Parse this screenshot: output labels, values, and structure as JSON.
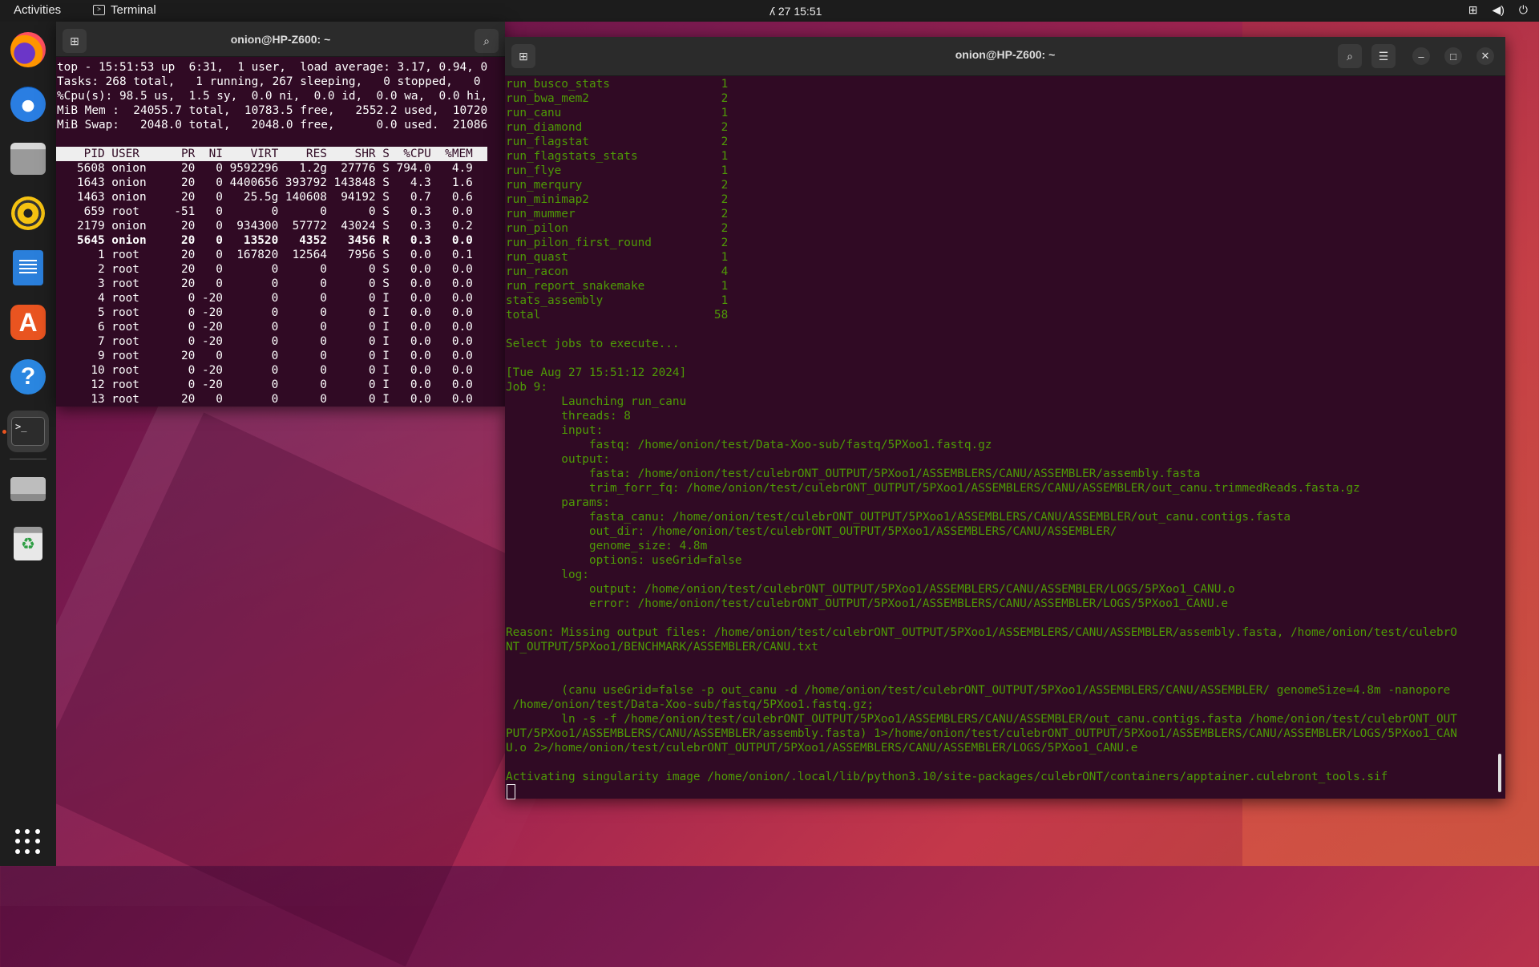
{
  "topbar": {
    "activities": "Activities",
    "app_name": "Terminal",
    "clock": "ʎ 27  15:51",
    "tray": [
      "network-icon",
      "volume-icon",
      "power-icon"
    ]
  },
  "dock": {
    "items": [
      "firefox",
      "thunderbird",
      "files",
      "rhythmbox",
      "libreoffice-writer",
      "app-center",
      "help",
      "terminal",
      "drive",
      "trash",
      "show-apps"
    ],
    "active": "terminal"
  },
  "term_top": {
    "title": "onion@HP-Z600: ~",
    "summary": [
      "top - 15:51:53 up  6:31,  1 user,  load average: 3.17, 0.94, 0",
      "Tasks: 268 total,   1 running, 267 sleeping,   0 stopped,   0",
      "%Cpu(s): 98.5 us,  1.5 sy,  0.0 ni,  0.0 id,  0.0 wa,  0.0 hi,",
      "MiB Mem :  24055.7 total,  10783.5 free,   2552.2 used,  10720",
      "MiB Swap:   2048.0 total,   2048.0 free,      0.0 used.  21086"
    ],
    "header": "    PID USER      PR  NI    VIRT    RES    SHR S  %CPU  %MEM ",
    "rows": [
      "   5608 onion     20   0 9592296   1.2g  27776 S 794.0   4.9",
      "   1643 onion     20   0 4400656 393792 143848 S   4.3   1.6",
      "   1463 onion     20   0   25.5g 140608  94192 S   0.7   0.6",
      "    659 root     -51   0       0      0      0 S   0.3   0.0",
      "   2179 onion     20   0  934300  57772  43024 S   0.3   0.2",
      "   5645 onion     20   0   13520   4352   3456 R   0.3   0.0",
      "      1 root      20   0  167820  12564   7956 S   0.0   0.1",
      "      2 root      20   0       0      0      0 S   0.0   0.0",
      "      3 root      20   0       0      0      0 S   0.0   0.0",
      "      4 root       0 -20       0      0      0 I   0.0   0.0",
      "      5 root       0 -20       0      0      0 I   0.0   0.0",
      "      6 root       0 -20       0      0      0 I   0.0   0.0",
      "      7 root       0 -20       0      0      0 I   0.0   0.0",
      "      9 root      20   0       0      0      0 I   0.0   0.0",
      "     10 root       0 -20       0      0      0 I   0.0   0.0",
      "     12 root       0 -20       0      0      0 I   0.0   0.0",
      "     13 root      20   0       0      0      0 I   0.0   0.0"
    ]
  },
  "term_main": {
    "title": "onion@HP-Z600: ~",
    "lines": [
      "run_busco_stats                1",
      "run_bwa_mem2                   2",
      "run_canu                       1",
      "run_diamond                    2",
      "run_flagstat                   2",
      "run_flagstats_stats            1",
      "run_flye                       1",
      "run_merqury                    2",
      "run_minimap2                   2",
      "run_mummer                     2",
      "run_pilon                      2",
      "run_pilon_first_round          2",
      "run_quast                      1",
      "run_racon                      4",
      "run_report_snakemake           1",
      "stats_assembly                 1",
      "total                         58",
      "",
      "Select jobs to execute...",
      "",
      "[Tue Aug 27 15:51:12 2024]",
      "Job 9:",
      "        Launching run_canu",
      "        threads: 8",
      "        input:",
      "            fastq: /home/onion/test/Data-Xoo-sub/fastq/5PXoo1.fastq.gz",
      "        output:",
      "            fasta: /home/onion/test/culebrONT_OUTPUT/5PXoo1/ASSEMBLERS/CANU/ASSEMBLER/assembly.fasta",
      "            trim_forr_fq: /home/onion/test/culebrONT_OUTPUT/5PXoo1/ASSEMBLERS/CANU/ASSEMBLER/out_canu.trimmedReads.fasta.gz",
      "        params:",
      "            fasta_canu: /home/onion/test/culebrONT_OUTPUT/5PXoo1/ASSEMBLERS/CANU/ASSEMBLER/out_canu.contigs.fasta",
      "            out_dir: /home/onion/test/culebrONT_OUTPUT/5PXoo1/ASSEMBLERS/CANU/ASSEMBLER/",
      "            genome_size: 4.8m",
      "            options: useGrid=false",
      "        log:",
      "            output: /home/onion/test/culebrONT_OUTPUT/5PXoo1/ASSEMBLERS/CANU/ASSEMBLER/LOGS/5PXoo1_CANU.o",
      "            error: /home/onion/test/culebrONT_OUTPUT/5PXoo1/ASSEMBLERS/CANU/ASSEMBLER/LOGS/5PXoo1_CANU.e",
      "",
      "Reason: Missing output files: /home/onion/test/culebrONT_OUTPUT/5PXoo1/ASSEMBLERS/CANU/ASSEMBLER/assembly.fasta, /home/onion/test/culebrO",
      "NT_OUTPUT/5PXoo1/BENCHMARK/ASSEMBLER/CANU.txt",
      "",
      "",
      "        (canu useGrid=false -p out_canu -d /home/onion/test/culebrONT_OUTPUT/5PXoo1/ASSEMBLERS/CANU/ASSEMBLER/ genomeSize=4.8m -nanopore",
      " /home/onion/test/Data-Xoo-sub/fastq/5PXoo1.fastq.gz;",
      "        ln -s -f /home/onion/test/culebrONT_OUTPUT/5PXoo1/ASSEMBLERS/CANU/ASSEMBLER/out_canu.contigs.fasta /home/onion/test/culebrONT_OUT",
      "PUT/5PXoo1/ASSEMBLERS/CANU/ASSEMBLER/assembly.fasta) 1>/home/onion/test/culebrONT_OUTPUT/5PXoo1/ASSEMBLERS/CANU/ASSEMBLER/LOGS/5PXoo1_CAN",
      "U.o 2>/home/onion/test/culebrONT_OUTPUT/5PXoo1/ASSEMBLERS/CANU/ASSEMBLER/LOGS/5PXoo1_CANU.e",
      "",
      "Activating singularity image /home/onion/.local/lib/python3.10/site-packages/culebrONT/containers/apptainer.culebront_tools.sif"
    ]
  }
}
